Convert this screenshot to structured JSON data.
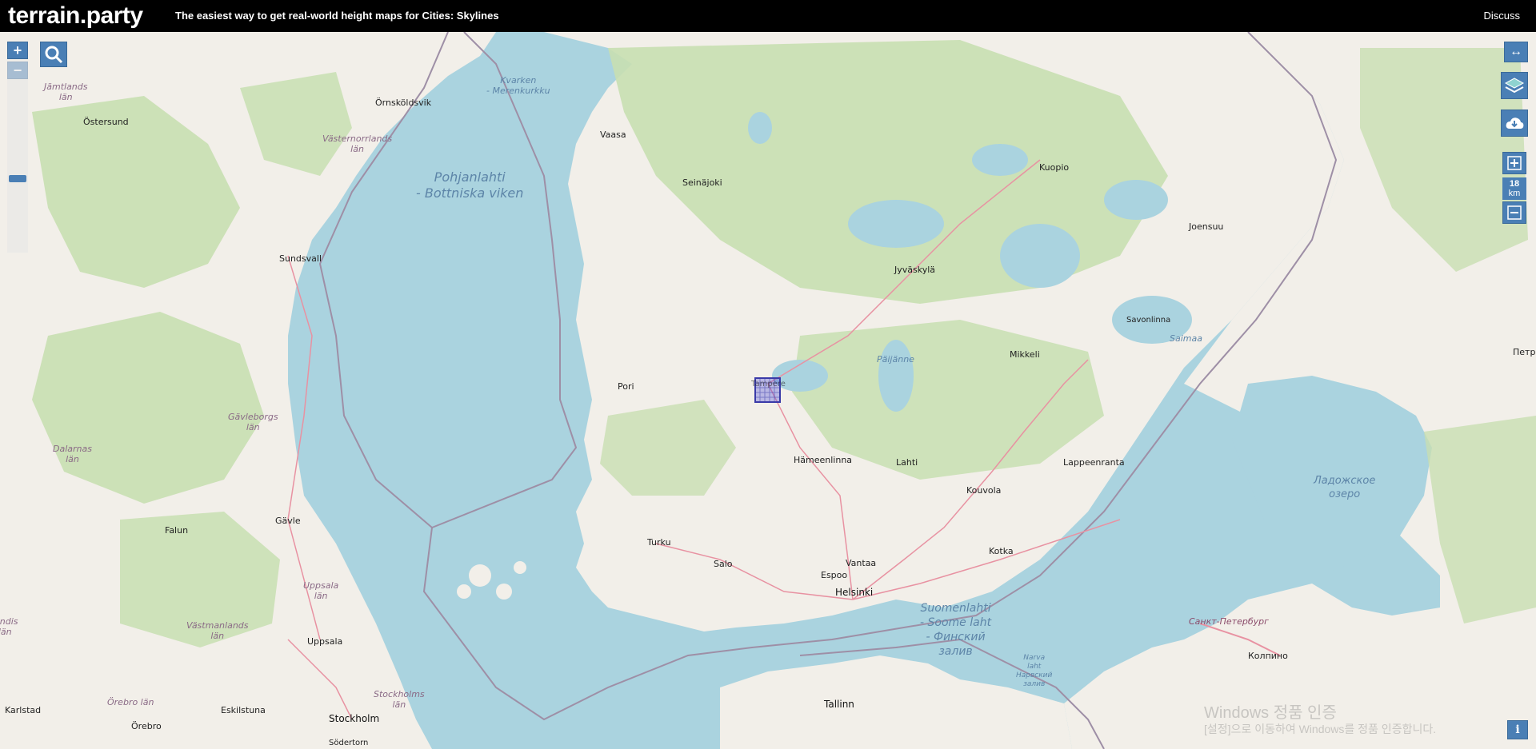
{
  "header": {
    "logo": "terrain.party",
    "tagline": "The easiest way to get real-world height maps for Cities: Skylines",
    "discuss_label": "Discuss"
  },
  "controls": {
    "zoom_in": "+",
    "zoom_out": "−",
    "resize_icon": "↔",
    "scale_value": "18",
    "scale_unit": "km",
    "info": "i"
  },
  "colors": {
    "land": "#f2efe9",
    "forest": "#c8dfb1",
    "water": "#aad3df",
    "border": "#9e8fa6",
    "road": "#e892a2",
    "selection": "#3a3aa8"
  },
  "map": {
    "cities": [
      {
        "name": "Örnsköldsvik"
      },
      {
        "name": "Östersund"
      },
      {
        "name": "Sundsvall"
      },
      {
        "name": "Gävle"
      },
      {
        "name": "Falun"
      },
      {
        "name": "Uppsala"
      },
      {
        "name": "Karlstad"
      },
      {
        "name": "Eskilstuna"
      },
      {
        "name": "Örebro"
      },
      {
        "name": "Stockholm"
      },
      {
        "name": "Södertorn"
      },
      {
        "name": "Vaasa"
      },
      {
        "name": "Seinäjoki"
      },
      {
        "name": "Kuopio"
      },
      {
        "name": "Joensuu"
      },
      {
        "name": "Jyväskylä"
      },
      {
        "name": "Savonlinna"
      },
      {
        "name": "Mikkeli"
      },
      {
        "name": "Pori"
      },
      {
        "name": "Tampere"
      },
      {
        "name": "Hämeenlinna"
      },
      {
        "name": "Lahti"
      },
      {
        "name": "Lappeenranta"
      },
      {
        "name": "Kouvola"
      },
      {
        "name": "Turku"
      },
      {
        "name": "Salo"
      },
      {
        "name": "Espoo"
      },
      {
        "name": "Vantaa"
      },
      {
        "name": "Helsinki"
      },
      {
        "name": "Kotka"
      },
      {
        "name": "Tallinn"
      },
      {
        "name": "Санкт-Петербург"
      },
      {
        "name": "Колпино"
      },
      {
        "name": "Петро"
      }
    ],
    "seas": [
      {
        "name": "Pohjanlahti\n- Bottniska viken"
      },
      {
        "name": "Kvarken\n- Merenkurkku"
      },
      {
        "name": "Suomenlahti\n- Soome laht\n- Финский\nзалив"
      },
      {
        "name": "Ладожское\nозеро"
      },
      {
        "name": "Päijänne"
      },
      {
        "name": "Saimaa"
      },
      {
        "name": "Narva\nlaht\nНарвский\nзалив"
      }
    ],
    "regions": [
      {
        "name": "Jämtlands\nlän"
      },
      {
        "name": "Västernorrlands\nlän"
      },
      {
        "name": "Gävleborgs\nlän"
      },
      {
        "name": "Dalarnas\nlän"
      },
      {
        "name": "Uppsala\nlän"
      },
      {
        "name": "Västmanlands\nlän"
      },
      {
        "name": "Stockholms\nlän"
      },
      {
        "name": "Örebro län"
      },
      {
        "name": "landis\nlän"
      }
    ]
  },
  "watermark": {
    "line1": "Windows 정품 인증",
    "line2": "[설정]으로 이동하여 Windows를 정품 인증합니다."
  }
}
